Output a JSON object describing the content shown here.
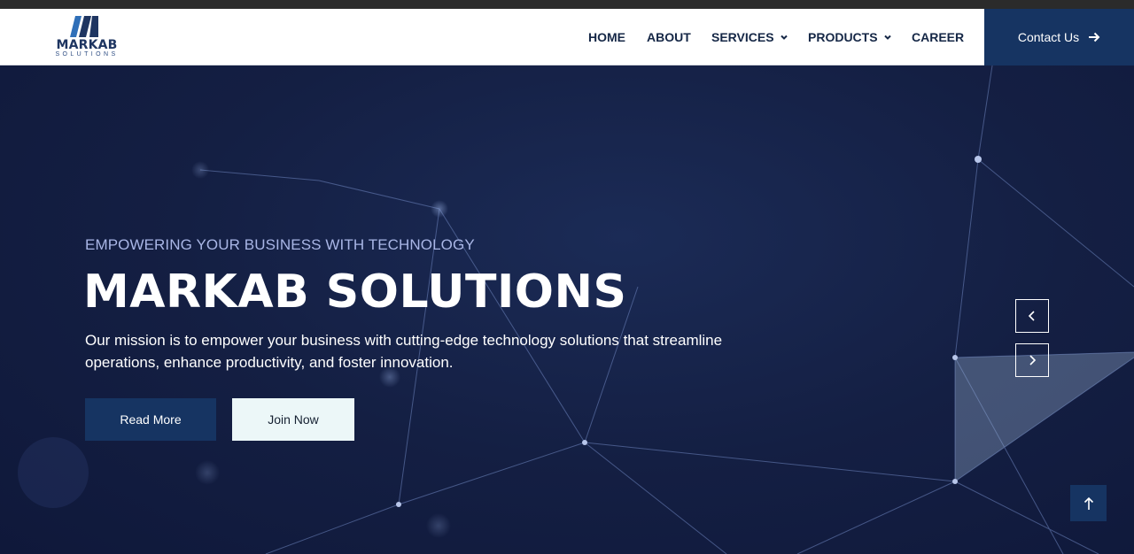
{
  "brand": {
    "name": "MARKAB",
    "sub": "SOLUTIONS",
    "color_primary": "#163462"
  },
  "nav": {
    "items": [
      {
        "label": "HOME",
        "dropdown": false
      },
      {
        "label": "ABOUT",
        "dropdown": false
      },
      {
        "label": "SERVICES",
        "dropdown": true
      },
      {
        "label": "PRODUCTS",
        "dropdown": true
      },
      {
        "label": "CAREER",
        "dropdown": false
      }
    ],
    "contact_label": "Contact Us",
    "contact_icon": "arrow-right-icon"
  },
  "hero": {
    "kicker": "EMPOWERING YOUR BUSINESS WITH TECHNOLOGY",
    "title": "MARKAB SOLUTIONS",
    "description": "Our mission is to empower your business with cutting-edge technology solutions that streamline operations, enhance productivity, and foster innovation.",
    "read_more_label": "Read More",
    "join_now_label": "Join Now",
    "prev_icon": "chevron-left-icon",
    "next_icon": "chevron-right-icon"
  },
  "scroll_top_icon": "arrow-up-icon"
}
